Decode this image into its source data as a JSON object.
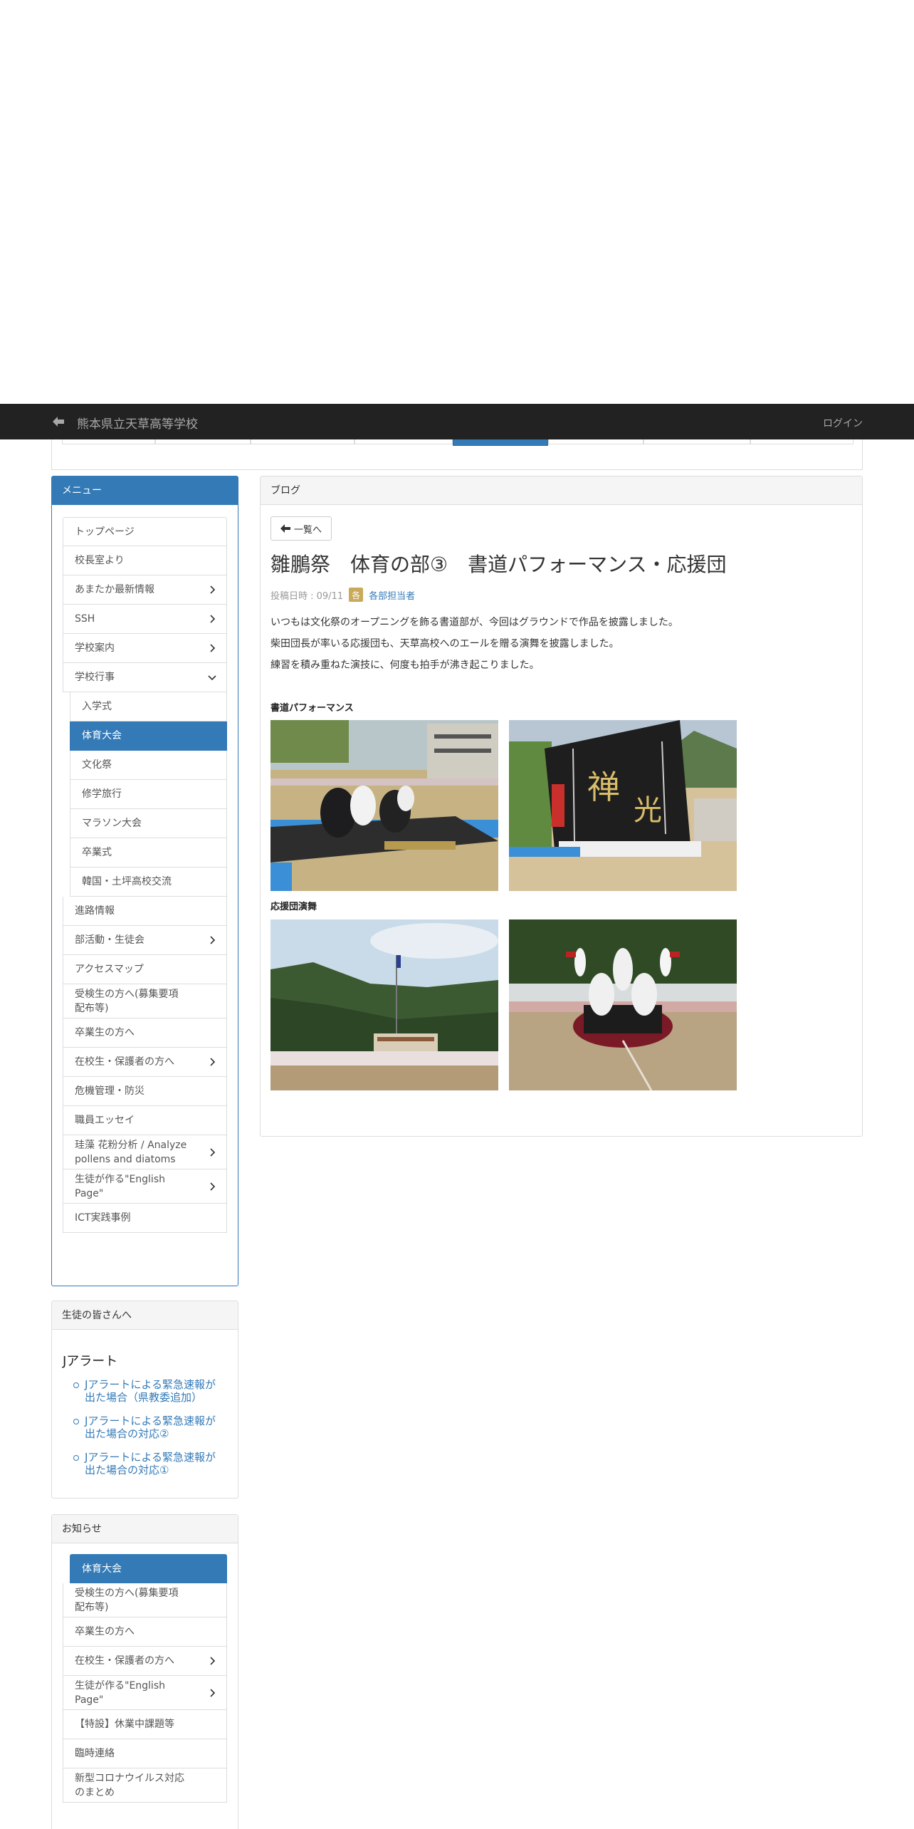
{
  "header": {
    "site_title": "熊本県立天草高等学校",
    "login": "ログイン"
  },
  "menu": {
    "title": "メニュー",
    "items": [
      {
        "label": "トップページ"
      },
      {
        "label": "校長室より"
      },
      {
        "label": "あまたか最新情報",
        "chevron": "right"
      },
      {
        "label": "SSH",
        "chevron": "right"
      },
      {
        "label": "学校案内",
        "chevron": "right"
      },
      {
        "label": "学校行事",
        "chevron": "down"
      },
      {
        "label": "入学式",
        "sub": true
      },
      {
        "label": "体育大会",
        "sub": true,
        "active": true
      },
      {
        "label": "文化祭",
        "sub": true
      },
      {
        "label": "修学旅行",
        "sub": true
      },
      {
        "label": "マラソン大会",
        "sub": true
      },
      {
        "label": "卒業式",
        "sub": true
      },
      {
        "label": "韓国・土坪高校交流",
        "sub": true
      },
      {
        "label": "進路情報"
      },
      {
        "label": "部活動・生徒会",
        "chevron": "right"
      },
      {
        "label": "アクセスマップ"
      },
      {
        "label": "受検生の方へ(募集要項\n配布等)"
      },
      {
        "label": "卒業生の方へ"
      },
      {
        "label": "在校生・保護者の方へ",
        "chevron": "right"
      },
      {
        "label": "危機管理・防災"
      },
      {
        "label": "職員エッセイ"
      },
      {
        "label": "珪藻 花粉分析 / Analyze\npollens and diatoms",
        "chevron": "right"
      },
      {
        "label": "生徒が作る\"English\nPage\"",
        "chevron": "right"
      },
      {
        "label": "ICT実践事例"
      }
    ]
  },
  "students_panel": {
    "title": "生徒の皆さんへ",
    "section_title": "Jアラート",
    "links": [
      "Jアラートによる緊急速報が\n出た場合（県教委追加）",
      "Jアラートによる緊急速報が\n出た場合の対応②",
      "Jアラートによる緊急速報が\n出た場合の対応①"
    ]
  },
  "news_panel": {
    "title": "お知らせ",
    "items": [
      {
        "label": "体育大会",
        "sub": true,
        "active": true
      },
      {
        "label": "受検生の方へ(募集要項\n配布等)"
      },
      {
        "label": "卒業生の方へ"
      },
      {
        "label": "在校生・保護者の方へ",
        "chevron": "right"
      },
      {
        "label": "生徒が作る\"English\nPage\"",
        "chevron": "right"
      },
      {
        "label": "【特設】休業中課題等"
      },
      {
        "label": "臨時連絡"
      },
      {
        "label": "新型コロナウイルス対応\nのまとめ"
      }
    ]
  },
  "blog": {
    "panel_title": "ブログ",
    "back_label": "一覧へ",
    "post_title": "雛鵬祭　体育の部③　書道パフォーマンス・応援団",
    "posted_label": "投稿日時 : 09/11",
    "category_icon": "各",
    "author": "各部担当者",
    "paragraphs": [
      "いつもは文化祭のオープニングを飾る書道部が、今回はグラウンドで作品を披露しました。",
      "柴田団長が率いる応援団も、天草高校へのエールを贈る演舞を披露しました。",
      "練習を積み重ねた演技に、何度も拍手が沸き起こりました。"
    ],
    "section1": "書道パフォーマンス",
    "section2": "応援団演舞"
  },
  "colors": {
    "primary": "#337ab7",
    "topbar": "#222222",
    "category": "#c9a95a"
  }
}
